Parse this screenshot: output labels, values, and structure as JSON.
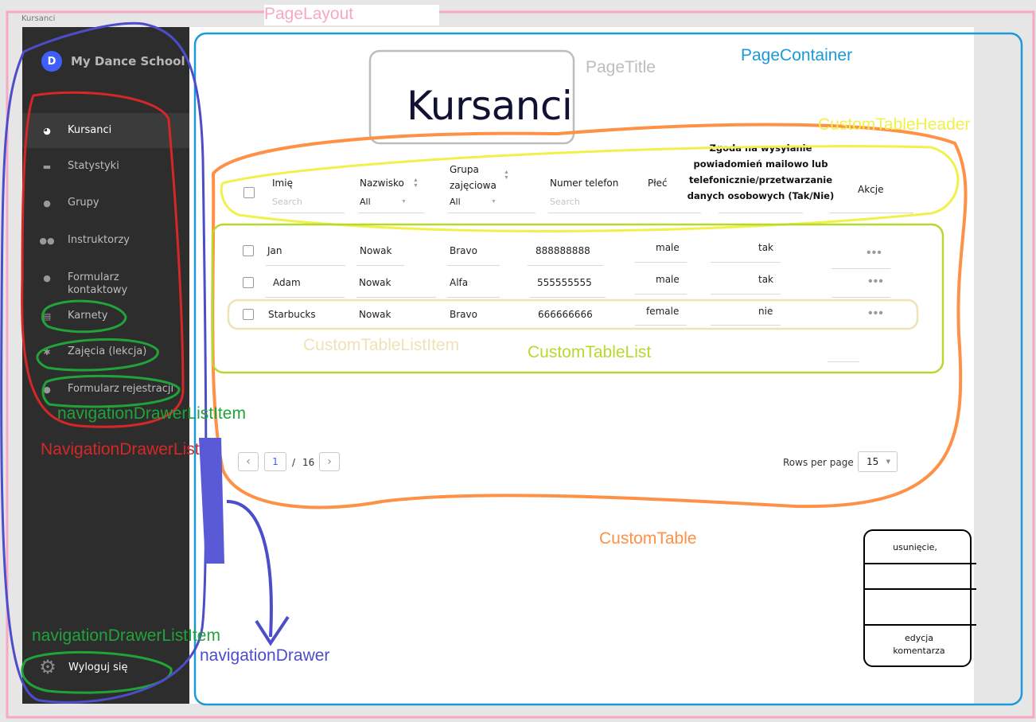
{
  "browser_tab": "Kursanci",
  "drawer": {
    "brand": {
      "logo_letter": "D",
      "name": "My Dance School"
    },
    "items": [
      {
        "label": "Kursanci",
        "icon": "pie-chart-icon",
        "active": true
      },
      {
        "label": "Statystyki",
        "icon": "card-icon"
      },
      {
        "label": "Grupy",
        "icon": "bulb-icon"
      },
      {
        "label": "Instruktorzy",
        "icon": "people-icon"
      },
      {
        "label": "Formularz kontaktowy",
        "icon": "person-icon"
      },
      {
        "label": "Karnety",
        "icon": "book-icon"
      },
      {
        "label": "Zajęcia (lekcja)",
        "icon": "gear-small-icon"
      },
      {
        "label": "Formularz rejestracji",
        "icon": "pin-icon"
      }
    ],
    "logout": {
      "label": "Wyloguj się",
      "icon": "gear-icon"
    }
  },
  "page": {
    "title": "Kursanci"
  },
  "table": {
    "headers": {
      "imie": "Imię",
      "nazwisko": "Nazwisko",
      "grupa": "Grupa zajęciowa",
      "telefon": "Numer telefon",
      "plec": "Płeć",
      "zgoda": "Zgoda na wysyłanie powiadomień mailowo lub telefonicznie/przetwarzanie danych osobowych (Tak/Nie)",
      "akcje": "Akcje"
    },
    "filters": {
      "imie_placeholder": "Search",
      "nazwisko_value": "All",
      "grupa_value": "All",
      "telefon_placeholder": "Search"
    },
    "rows": [
      {
        "imie": "Jan",
        "nazwisko": "Nowak",
        "grupa": "Bravo",
        "telefon": "888888888",
        "plec": "male",
        "zgoda": "tak",
        "akcje": "•••"
      },
      {
        "imie": "Adam",
        "nazwisko": "Nowak",
        "grupa": "Alfa",
        "telefon": "555555555",
        "plec": "male",
        "zgoda": "tak",
        "akcje": "•••"
      },
      {
        "imie": "Starbucks",
        "nazwisko": "Nowak",
        "grupa": "Bravo",
        "telefon": "666666666",
        "plec": "female",
        "zgoda": "nie",
        "akcje": "•••"
      }
    ]
  },
  "pagination": {
    "prev": "‹",
    "next": "›",
    "current_page": "1",
    "separator": "/",
    "total_pages": "16",
    "rows_per_page_label": "Rows per page",
    "rows_per_page_value": "15"
  },
  "popup": {
    "item_1": "usunięcie,",
    "item_2": "edycja komentarza"
  },
  "annotations": {
    "page_layout": "PageLayout",
    "page_container": "PageContainer",
    "page_title": "PageTitle",
    "custom_table_header": "CustomTableHeader",
    "custom_table_list_item": "CustomTableListItem",
    "custom_table_list": "CustomTableList",
    "navigation_drawer_list_item_1": "navigationDrawerListItem",
    "navigation_drawer_list": "NavigationDrawerList",
    "custom_table": "CustomTable",
    "navigation_drawer_list_item_2": "navigationDrawerListItem",
    "navigation_drawer": "navigationDrawer",
    "colors": {
      "page_layout": "#f7a8c4",
      "page_container": "#1a9ad6",
      "page_title": "#bdbdbd",
      "custom_table_header": "#f2f04a",
      "custom_table_list_item": "#f0e2b6",
      "custom_table_list": "#b5d92e",
      "navigation_drawer_list_item": "#22a33a",
      "navigation_drawer_list": "#d42828",
      "custom_table": "#ff9146",
      "navigation_drawer": "#4d4dc9"
    }
  }
}
